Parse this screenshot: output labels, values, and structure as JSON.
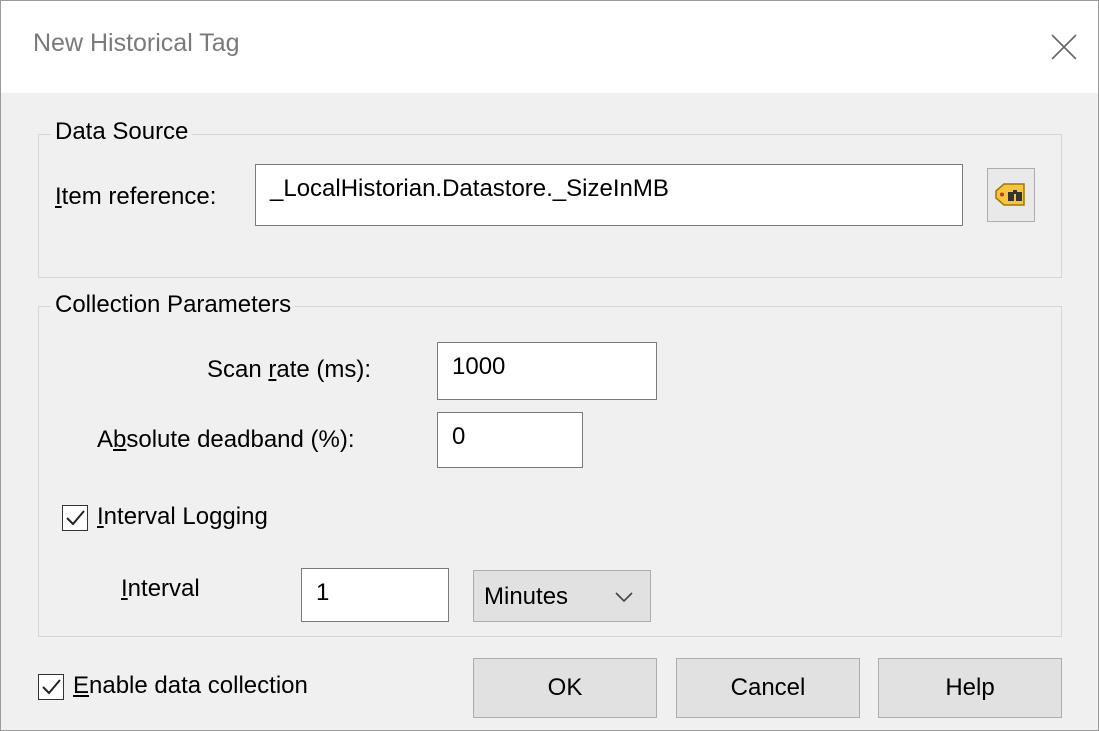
{
  "window": {
    "title": "New Historical Tag"
  },
  "data_source": {
    "legend": "Data Source",
    "item_reference_label_pre": "",
    "item_reference_label_key": "I",
    "item_reference_label_post": "tem reference:",
    "item_reference_value": "_LocalHistorian.Datastore._SizeInMB",
    "browse_icon": "tag-browse-icon"
  },
  "collection": {
    "legend": "Collection Parameters",
    "scan_rate_pre": "Scan ",
    "scan_rate_key": "r",
    "scan_rate_post": "ate (ms):",
    "scan_rate_value": "1000",
    "deadband_pre": "A",
    "deadband_key": "b",
    "deadband_post": "solute deadband (%):",
    "deadband_value": "0",
    "interval_logging_key": "I",
    "interval_logging_post": "nterval Logging",
    "interval_logging_checked": true,
    "interval_key": "I",
    "interval_post": "nterval",
    "interval_value": "1",
    "interval_unit": "Minutes"
  },
  "footer": {
    "enable_key": "E",
    "enable_post": "nable data collection",
    "enable_checked": true,
    "ok_label": "OK",
    "cancel_label": "Cancel",
    "help_label": "Help"
  },
  "colors": {
    "window_bg": "#f0f0f0",
    "button_bg": "#e1e1e1",
    "title_text": "#7a7a7a"
  }
}
